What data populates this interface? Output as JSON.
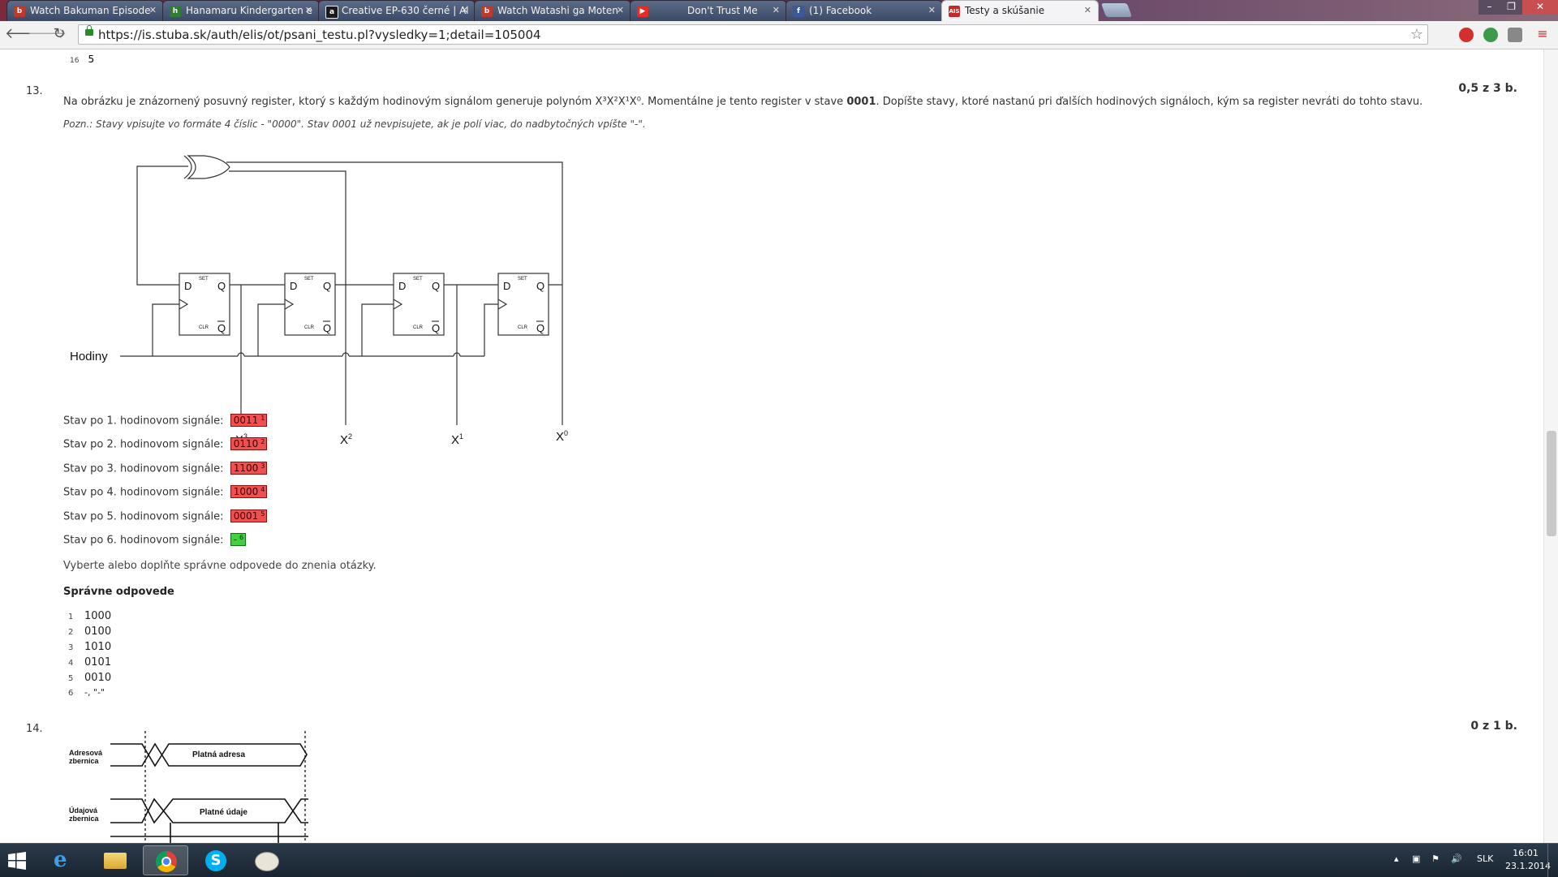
{
  "browser": {
    "tabs": [
      {
        "title": "Watch Bakuman Episode",
        "favicon": "video-site-icon",
        "color": "#c0392b",
        "active": false
      },
      {
        "title": "Hanamaru Kindergarten e",
        "favicon": "anime-site-icon",
        "color": "#2e7d32",
        "active": false
      },
      {
        "title": "Creative EP-630 černé | Al",
        "favicon": "shop-a-icon",
        "color": "#1a1a1a",
        "active": false
      },
      {
        "title": "Watch Watashi ga Moten",
        "favicon": "video-site-icon",
        "color": "#c0392b",
        "active": false
      },
      {
        "title": "Don't Trust Me",
        "favicon": "youtube-icon",
        "color": "#e52d27",
        "active": false
      },
      {
        "title": "(1) Facebook",
        "favicon": "facebook-icon",
        "color": "#3b5998",
        "active": false
      },
      {
        "title": "Testy a skúšanie",
        "favicon": "ais-icon",
        "color": "#c62828",
        "active": true
      }
    ],
    "url": "https://is.stuba.sk/auth/elis/ot/psani_testu.pl?vysledky=1;detail=105004"
  },
  "page": {
    "prev_answer": {
      "index": "16",
      "value": "5"
    },
    "q13": {
      "number": "13.",
      "points": "0,5 z 3 b.",
      "text_before_poly": "Na obrázku je znázornený posuvný register, ktorý s každým hodinovým signálom generuje polynóm ",
      "polynomial": "X³X²X¹X⁰",
      "text_mid": ". Momentálne je tento register v stave ",
      "state_bold": "0001",
      "text_after": ". Dopíšte stavy, ktoré nastanú pri ďalších hodinových signáloch, kým sa register nevráti do tohto stavu.",
      "note": "Pozn.: Stavy vpisujte vo formáte 4 číslic - \"0000\". Stav 0001 už nevpisujete, ak je polí viac, do nadbytočných vpíšte \"-\".",
      "diagram": {
        "clock_label": "Hodiny",
        "ff_d": "D",
        "ff_q": "Q",
        "ff_qbar": "Q",
        "ff_set": "SET",
        "ff_clr": "CLR",
        "tap_base": "X",
        "taps": [
          {
            "base": "X",
            "exp": "3"
          },
          {
            "base": "X",
            "exp": "2"
          },
          {
            "base": "X",
            "exp": "1"
          },
          {
            "base": "X",
            "exp": "0"
          }
        ]
      },
      "states": [
        {
          "label": "Stav po 1. hodinovom signále:",
          "answer": "0011",
          "sup": "1",
          "correct": false
        },
        {
          "label": "Stav po 2. hodinovom signále:",
          "answer": "0110",
          "sup": "2",
          "correct": false
        },
        {
          "label": "Stav po 3. hodinovom signále:",
          "answer": "1100",
          "sup": "3",
          "correct": false
        },
        {
          "label": "Stav po 4. hodinovom signále:",
          "answer": "1000",
          "sup": "4",
          "correct": false
        },
        {
          "label": "Stav po 5. hodinovom signále:",
          "answer": "0001",
          "sup": "5",
          "correct": false
        },
        {
          "label": "Stav po 6. hodinovom signále:",
          "answer": "-",
          "sup": "6",
          "correct": true
        }
      ],
      "instruction": "Vyberte alebo doplňte správne odpovede do znenia otázky.",
      "correct_heading": "Správne odpovede",
      "correct_answers": [
        {
          "idx": "1",
          "value": "1000"
        },
        {
          "idx": "2",
          "value": "0100"
        },
        {
          "idx": "3",
          "value": "1010"
        },
        {
          "idx": "4",
          "value": "0101"
        },
        {
          "idx": "5",
          "value": "0010"
        },
        {
          "idx": "6",
          "value": "-, \"-\""
        }
      ]
    },
    "q14": {
      "number": "14.",
      "points": "0 z 1 b.",
      "bus1_label_1": "Adresová",
      "bus1_label_2": "zbernica",
      "bus1_text": "Platná adresa",
      "bus2_label_1": "Údajová",
      "bus2_label_2": "zbernica",
      "bus2_text": "Platné údaje"
    }
  },
  "taskbar": {
    "apps": [
      "windows-start-icon",
      "internet-explorer-icon",
      "file-explorer-icon",
      "chrome-icon",
      "skype-icon",
      "paint-icon"
    ],
    "language": "SLK",
    "time": "16:01",
    "date": "23.1.2014"
  }
}
